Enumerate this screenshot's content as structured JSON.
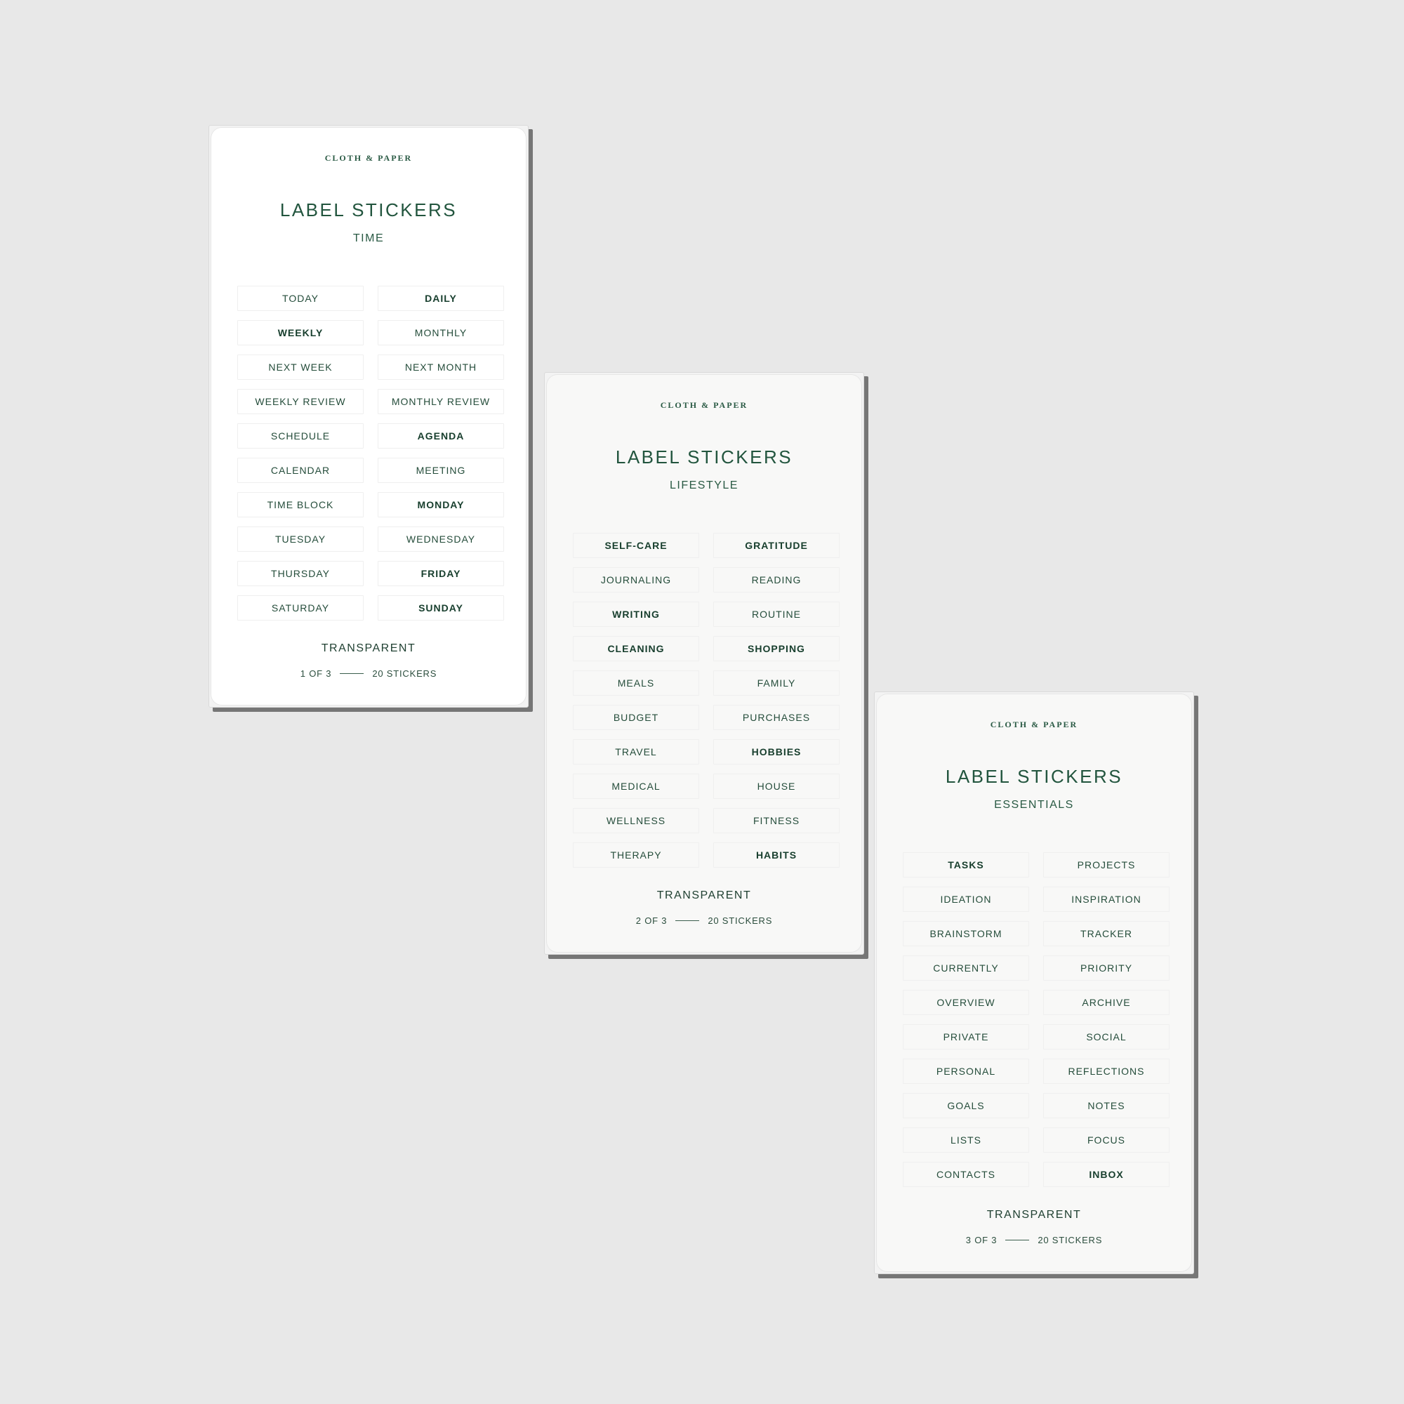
{
  "sheets": [
    {
      "brand": "CLOTH & PAPER",
      "title": "LABEL STICKERS",
      "subtitle": "TIME",
      "labels": [
        {
          "text": "TODAY",
          "bold": false
        },
        {
          "text": "DAILY",
          "bold": true
        },
        {
          "text": "WEEKLY",
          "bold": true
        },
        {
          "text": "MONTHLY",
          "bold": false
        },
        {
          "text": "NEXT WEEK",
          "bold": false
        },
        {
          "text": "NEXT MONTH",
          "bold": false
        },
        {
          "text": "WEEKLY REVIEW",
          "bold": false
        },
        {
          "text": "MONTHLY REVIEW",
          "bold": false
        },
        {
          "text": "SCHEDULE",
          "bold": false
        },
        {
          "text": "AGENDA",
          "bold": true
        },
        {
          "text": "CALENDAR",
          "bold": false
        },
        {
          "text": "MEETING",
          "bold": false
        },
        {
          "text": "TIME BLOCK",
          "bold": false
        },
        {
          "text": "MONDAY",
          "bold": true
        },
        {
          "text": "TUESDAY",
          "bold": false
        },
        {
          "text": "WEDNESDAY",
          "bold": false
        },
        {
          "text": "THURSDAY",
          "bold": false
        },
        {
          "text": "FRIDAY",
          "bold": true
        },
        {
          "text": "SATURDAY",
          "bold": false
        },
        {
          "text": "SUNDAY",
          "bold": true
        }
      ],
      "finish": "TRANSPARENT",
      "sheet_number": "1 OF 3",
      "count": "20 STICKERS"
    },
    {
      "brand": "CLOTH & PAPER",
      "title": "LABEL STICKERS",
      "subtitle": "LIFESTYLE",
      "labels": [
        {
          "text": "SELF-CARE",
          "bold": true
        },
        {
          "text": "GRATITUDE",
          "bold": true
        },
        {
          "text": "JOURNALING",
          "bold": false
        },
        {
          "text": "READING",
          "bold": false
        },
        {
          "text": "WRITING",
          "bold": true
        },
        {
          "text": "ROUTINE",
          "bold": false
        },
        {
          "text": "CLEANING",
          "bold": true
        },
        {
          "text": "SHOPPING",
          "bold": true
        },
        {
          "text": "MEALS",
          "bold": false
        },
        {
          "text": "FAMILY",
          "bold": false
        },
        {
          "text": "BUDGET",
          "bold": false
        },
        {
          "text": "PURCHASES",
          "bold": false
        },
        {
          "text": "TRAVEL",
          "bold": false
        },
        {
          "text": "HOBBIES",
          "bold": true
        },
        {
          "text": "MEDICAL",
          "bold": false
        },
        {
          "text": "HOUSE",
          "bold": false
        },
        {
          "text": "WELLNESS",
          "bold": false
        },
        {
          "text": "FITNESS",
          "bold": false
        },
        {
          "text": "THERAPY",
          "bold": false
        },
        {
          "text": "HABITS",
          "bold": true
        }
      ],
      "finish": "TRANSPARENT",
      "sheet_number": "2 OF 3",
      "count": "20 STICKERS"
    },
    {
      "brand": "CLOTH & PAPER",
      "title": "LABEL STICKERS",
      "subtitle": "ESSENTIALS",
      "labels": [
        {
          "text": "TASKS",
          "bold": true
        },
        {
          "text": "PROJECTS",
          "bold": false
        },
        {
          "text": "IDEATION",
          "bold": false
        },
        {
          "text": "INSPIRATION",
          "bold": false
        },
        {
          "text": "BRAINSTORM",
          "bold": false
        },
        {
          "text": "TRACKER",
          "bold": false
        },
        {
          "text": "CURRENTLY",
          "bold": false
        },
        {
          "text": "PRIORITY",
          "bold": false
        },
        {
          "text": "OVERVIEW",
          "bold": false
        },
        {
          "text": "ARCHIVE",
          "bold": false
        },
        {
          "text": "PRIVATE",
          "bold": false
        },
        {
          "text": "SOCIAL",
          "bold": false
        },
        {
          "text": "PERSONAL",
          "bold": false
        },
        {
          "text": "REFLECTIONS",
          "bold": false
        },
        {
          "text": "GOALS",
          "bold": false
        },
        {
          "text": "NOTES",
          "bold": false
        },
        {
          "text": "LISTS",
          "bold": false
        },
        {
          "text": "FOCUS",
          "bold": false
        },
        {
          "text": "CONTACTS",
          "bold": false
        },
        {
          "text": "INBOX",
          "bold": true
        }
      ],
      "finish": "TRANSPARENT",
      "sheet_number": "3 OF 3",
      "count": "20 STICKERS"
    }
  ],
  "colors": {
    "background": "#e8e8e8",
    "ink_green": "#204a38",
    "backing_shadow": "#767676"
  }
}
